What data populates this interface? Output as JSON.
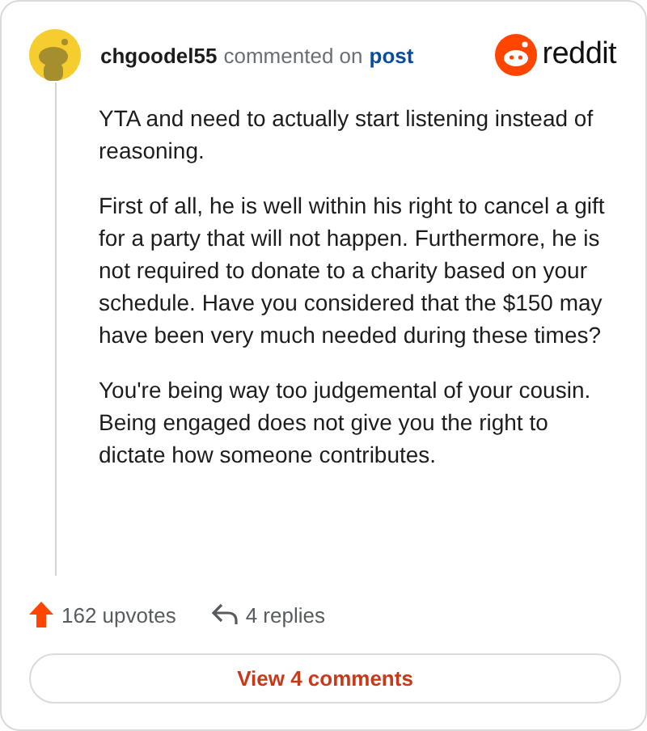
{
  "header": {
    "username": "chgoodel55",
    "action": "commented on",
    "link": "post",
    "brand": "reddit"
  },
  "comment": {
    "paragraphs": [
      "YTA and need to actually start listening instead of reasoning.",
      "First of all, he is well within his right to cancel a gift for a party that will not happen. Furthermore, he is not required to donate to a charity based on your schedule. Have you considered that the $150 may have been very much needed during these times?",
      "You're being way too judgemental of your cousin. Being engaged does not give you the right to dictate how someone contributes."
    ]
  },
  "footer": {
    "upvotes": "162 upvotes",
    "replies": "4 replies",
    "button": "View 4 comments"
  }
}
